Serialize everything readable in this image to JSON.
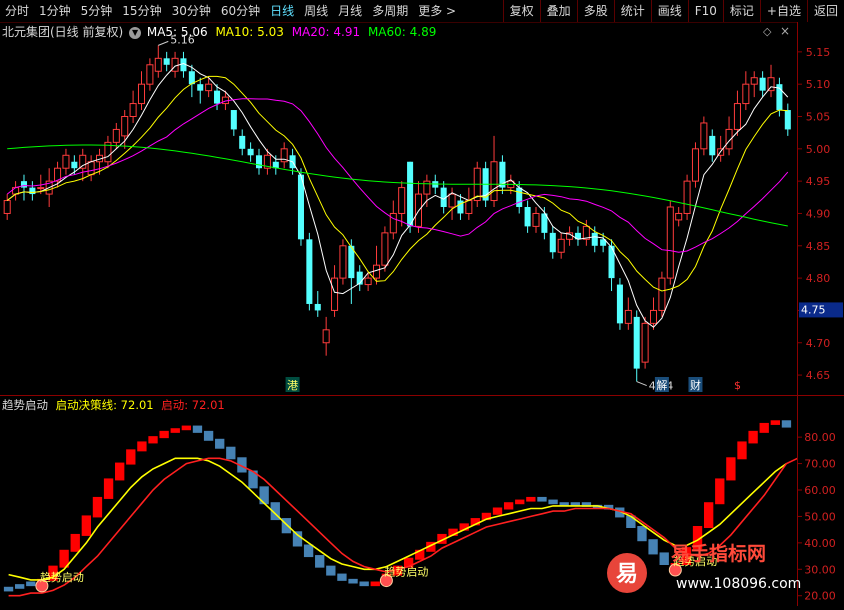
{
  "toolbar": {
    "left_items": [
      "分时",
      "1分钟",
      "5分钟",
      "15分钟",
      "30分钟",
      "60分钟",
      "日线",
      "周线",
      "月线",
      "多周期",
      "更多 >"
    ],
    "active_index": 6,
    "right_items": [
      "复权",
      "叠加",
      "多股",
      "统计",
      "画线",
      "F10",
      "标记",
      "+自选",
      "返回"
    ]
  },
  "main_title": {
    "stock": "北元集团(日线 前复权)",
    "ma5": "MA5: 5.06",
    "ma10": "MA10: 5.03",
    "ma20": "MA20: 4.91",
    "ma60": "MA60: 4.89"
  },
  "sub_title": {
    "name": "趋势启动",
    "line1": "启动决策线: 72.01",
    "line2": "启动: 72.01"
  },
  "price_axis": {
    "ticks": [
      "5.15",
      "5.10",
      "5.05",
      "5.00",
      "4.95",
      "4.90",
      "4.85",
      "4.80",
      "4.75",
      "4.70",
      "4.65"
    ],
    "current": "4.75"
  },
  "indicator_axis": {
    "ticks": [
      "80.00",
      "70.00",
      "60.00",
      "50.00",
      "40.00",
      "30.00",
      "20.00"
    ]
  },
  "annotations": {
    "high_label": "5.16",
    "low_label": "4.64",
    "event_labels": [
      "港",
      "解",
      "财",
      "$"
    ]
  },
  "signals": [
    "趋势启动",
    "趋势启动",
    "趋势启动"
  ],
  "watermark": {
    "site": "易手指标网",
    "url": "www.108096.com",
    "logo_char": "易"
  },
  "colors": {
    "up": "#ff3c3c",
    "down": "#54ffff",
    "ma5": "#ffffff",
    "ma10": "#ffff00",
    "ma20": "#ff00ff",
    "ma60": "#00ff00",
    "bar_up": "#ff0000",
    "bar_down": "#4682b4",
    "decision_line": "#ffff00",
    "start_line": "#ff2020"
  },
  "chart_data": {
    "type": "candlestick",
    "y_range": [
      4.63,
      5.19
    ],
    "candles": [
      {
        "o": 4.9,
        "c": 4.92,
        "h": 4.93,
        "l": 4.89
      },
      {
        "o": 4.93,
        "c": 4.94,
        "h": 4.95,
        "l": 4.92
      },
      {
        "o": 4.95,
        "c": 4.94,
        "h": 4.96,
        "l": 4.92
      },
      {
        "o": 4.94,
        "c": 4.93,
        "h": 4.95,
        "l": 4.92
      },
      {
        "o": 4.94,
        "c": 4.94,
        "h": 4.96,
        "l": 4.93
      },
      {
        "o": 4.93,
        "c": 4.95,
        "h": 4.97,
        "l": 4.91
      },
      {
        "o": 4.95,
        "c": 4.97,
        "h": 4.98,
        "l": 4.94
      },
      {
        "o": 4.97,
        "c": 4.99,
        "h": 5.0,
        "l": 4.96
      },
      {
        "o": 4.98,
        "c": 4.97,
        "h": 4.99,
        "l": 4.96
      },
      {
        "o": 4.97,
        "c": 4.99,
        "h": 5.0,
        "l": 4.95
      },
      {
        "o": 4.96,
        "c": 4.98,
        "h": 4.99,
        "l": 4.95
      },
      {
        "o": 4.98,
        "c": 4.99,
        "h": 5.0,
        "l": 4.96
      },
      {
        "o": 4.98,
        "c": 5.01,
        "h": 5.02,
        "l": 4.97
      },
      {
        "o": 5.01,
        "c": 5.03,
        "h": 5.04,
        "l": 5.0
      },
      {
        "o": 5.02,
        "c": 5.05,
        "h": 5.06,
        "l": 5.0
      },
      {
        "o": 5.05,
        "c": 5.07,
        "h": 5.09,
        "l": 5.04
      },
      {
        "o": 5.07,
        "c": 5.1,
        "h": 5.12,
        "l": 5.06
      },
      {
        "o": 5.1,
        "c": 5.13,
        "h": 5.14,
        "l": 5.09
      },
      {
        "o": 5.12,
        "c": 5.14,
        "h": 5.16,
        "l": 5.11
      },
      {
        "o": 5.14,
        "c": 5.13,
        "h": 5.15,
        "l": 5.12
      },
      {
        "o": 5.12,
        "c": 5.14,
        "h": 5.15,
        "l": 5.11
      },
      {
        "o": 5.14,
        "c": 5.12,
        "h": 5.15,
        "l": 5.11
      },
      {
        "o": 5.12,
        "c": 5.1,
        "h": 5.13,
        "l": 5.08
      },
      {
        "o": 5.1,
        "c": 5.09,
        "h": 5.11,
        "l": 5.07
      },
      {
        "o": 5.09,
        "c": 5.1,
        "h": 5.11,
        "l": 5.08
      },
      {
        "o": 5.09,
        "c": 5.07,
        "h": 5.1,
        "l": 5.06
      },
      {
        "o": 5.07,
        "c": 5.08,
        "h": 5.09,
        "l": 5.06
      },
      {
        "o": 5.06,
        "c": 5.03,
        "h": 5.06,
        "l": 5.02
      },
      {
        "o": 5.02,
        "c": 5.0,
        "h": 5.03,
        "l": 4.99
      },
      {
        "o": 5.0,
        "c": 4.99,
        "h": 5.01,
        "l": 4.98
      },
      {
        "o": 4.99,
        "c": 4.97,
        "h": 5.0,
        "l": 4.96
      },
      {
        "o": 4.97,
        "c": 4.99,
        "h": 5.0,
        "l": 4.96
      },
      {
        "o": 4.98,
        "c": 4.97,
        "h": 4.99,
        "l": 4.96
      },
      {
        "o": 4.98,
        "c": 5.0,
        "h": 5.01,
        "l": 4.97
      },
      {
        "o": 4.99,
        "c": 4.97,
        "h": 5.0,
        "l": 4.96
      },
      {
        "o": 4.96,
        "c": 4.86,
        "h": 4.97,
        "l": 4.85
      },
      {
        "o": 4.86,
        "c": 4.76,
        "h": 4.87,
        "l": 4.75
      },
      {
        "o": 4.76,
        "c": 4.75,
        "h": 4.78,
        "l": 4.74
      },
      {
        "o": 4.7,
        "c": 4.72,
        "h": 4.74,
        "l": 4.68
      },
      {
        "o": 4.75,
        "c": 4.8,
        "h": 4.82,
        "l": 4.74
      },
      {
        "o": 4.8,
        "c": 4.85,
        "h": 4.86,
        "l": 4.79
      },
      {
        "o": 4.85,
        "c": 4.8,
        "h": 4.86,
        "l": 4.76
      },
      {
        "o": 4.81,
        "c": 4.79,
        "h": 4.82,
        "l": 4.78
      },
      {
        "o": 4.79,
        "c": 4.8,
        "h": 4.81,
        "l": 4.78
      },
      {
        "o": 4.8,
        "c": 4.82,
        "h": 4.85,
        "l": 4.79
      },
      {
        "o": 4.82,
        "c": 4.87,
        "h": 4.88,
        "l": 4.81
      },
      {
        "o": 4.87,
        "c": 4.9,
        "h": 4.92,
        "l": 4.86
      },
      {
        "o": 4.9,
        "c": 4.94,
        "h": 4.95,
        "l": 4.88
      },
      {
        "o": 4.98,
        "c": 4.88,
        "h": 4.98,
        "l": 4.87
      },
      {
        "o": 4.88,
        "c": 4.93,
        "h": 4.95,
        "l": 4.87
      },
      {
        "o": 4.93,
        "c": 4.95,
        "h": 4.96,
        "l": 4.91
      },
      {
        "o": 4.95,
        "c": 4.94,
        "h": 4.96,
        "l": 4.93
      },
      {
        "o": 4.94,
        "c": 4.91,
        "h": 4.95,
        "l": 4.9
      },
      {
        "o": 4.91,
        "c": 4.93,
        "h": 4.94,
        "l": 4.89
      },
      {
        "o": 4.92,
        "c": 4.9,
        "h": 4.93,
        "l": 4.89
      },
      {
        "o": 4.9,
        "c": 4.92,
        "h": 4.94,
        "l": 4.89
      },
      {
        "o": 4.92,
        "c": 4.97,
        "h": 4.98,
        "l": 4.91
      },
      {
        "o": 4.97,
        "c": 4.92,
        "h": 4.98,
        "l": 4.91
      },
      {
        "o": 4.92,
        "c": 4.98,
        "h": 5.02,
        "l": 4.91
      },
      {
        "o": 4.98,
        "c": 4.94,
        "h": 4.99,
        "l": 4.93
      },
      {
        "o": 4.94,
        "c": 4.95,
        "h": 4.96,
        "l": 4.93
      },
      {
        "o": 4.94,
        "c": 4.91,
        "h": 4.95,
        "l": 4.9
      },
      {
        "o": 4.91,
        "c": 4.88,
        "h": 4.92,
        "l": 4.87
      },
      {
        "o": 4.88,
        "c": 4.9,
        "h": 4.91,
        "l": 4.87
      },
      {
        "o": 4.9,
        "c": 4.87,
        "h": 4.91,
        "l": 4.86
      },
      {
        "o": 4.87,
        "c": 4.84,
        "h": 4.88,
        "l": 4.83
      },
      {
        "o": 4.84,
        "c": 4.86,
        "h": 4.87,
        "l": 4.83
      },
      {
        "o": 4.86,
        "c": 4.87,
        "h": 4.88,
        "l": 4.85
      },
      {
        "o": 4.87,
        "c": 4.86,
        "h": 4.88,
        "l": 4.85
      },
      {
        "o": 4.86,
        "c": 4.88,
        "h": 4.89,
        "l": 4.85
      },
      {
        "o": 4.87,
        "c": 4.85,
        "h": 4.88,
        "l": 4.84
      },
      {
        "o": 4.86,
        "c": 4.85,
        "h": 4.87,
        "l": 4.84
      },
      {
        "o": 4.85,
        "c": 4.8,
        "h": 4.86,
        "l": 4.78
      },
      {
        "o": 4.79,
        "c": 4.73,
        "h": 4.8,
        "l": 4.72
      },
      {
        "o": 4.73,
        "c": 4.75,
        "h": 4.77,
        "l": 4.72
      },
      {
        "o": 4.74,
        "c": 4.66,
        "h": 4.75,
        "l": 4.64
      },
      {
        "o": 4.67,
        "c": 4.73,
        "h": 4.74,
        "l": 4.66
      },
      {
        "o": 4.73,
        "c": 4.75,
        "h": 4.77,
        "l": 4.72
      },
      {
        "o": 4.75,
        "c": 4.8,
        "h": 4.81,
        "l": 4.74
      },
      {
        "o": 4.8,
        "c": 4.91,
        "h": 4.92,
        "l": 4.79
      },
      {
        "o": 4.89,
        "c": 4.9,
        "h": 4.91,
        "l": 4.88
      },
      {
        "o": 4.9,
        "c": 4.95,
        "h": 4.96,
        "l": 4.89
      },
      {
        "o": 4.95,
        "c": 5.0,
        "h": 5.01,
        "l": 4.94
      },
      {
        "o": 5.0,
        "c": 5.04,
        "h": 5.05,
        "l": 4.99
      },
      {
        "o": 5.02,
        "c": 4.99,
        "h": 5.03,
        "l": 4.98
      },
      {
        "o": 4.99,
        "c": 5.0,
        "h": 5.02,
        "l": 4.98
      },
      {
        "o": 5.0,
        "c": 5.03,
        "h": 5.05,
        "l": 4.99
      },
      {
        "o": 5.03,
        "c": 5.07,
        "h": 5.09,
        "l": 5.02
      },
      {
        "o": 5.07,
        "c": 5.1,
        "h": 5.12,
        "l": 5.06
      },
      {
        "o": 5.1,
        "c": 5.11,
        "h": 5.12,
        "l": 5.08
      },
      {
        "o": 5.11,
        "c": 5.09,
        "h": 5.12,
        "l": 5.08
      },
      {
        "o": 5.09,
        "c": 5.11,
        "h": 5.13,
        "l": 5.08
      },
      {
        "o": 5.1,
        "c": 5.06,
        "h": 5.11,
        "l": 5.05
      },
      {
        "o": 5.06,
        "c": 5.03,
        "h": 5.07,
        "l": 5.02
      }
    ],
    "indicator_y_range": [
      18,
      88
    ],
    "histogram": [
      {
        "v": 23,
        "up": false
      },
      {
        "v": 24,
        "up": false
      },
      {
        "v": 25,
        "up": false
      },
      {
        "v": 26,
        "up": true
      },
      {
        "v": 31,
        "up": true
      },
      {
        "v": 37,
        "up": true
      },
      {
        "v": 43,
        "up": true
      },
      {
        "v": 50,
        "up": true
      },
      {
        "v": 57,
        "up": true
      },
      {
        "v": 64,
        "up": true
      },
      {
        "v": 70,
        "up": true
      },
      {
        "v": 75,
        "up": true
      },
      {
        "v": 78,
        "up": true
      },
      {
        "v": 80,
        "up": true
      },
      {
        "v": 82,
        "up": true
      },
      {
        "v": 83,
        "up": true
      },
      {
        "v": 84,
        "up": true
      },
      {
        "v": 82,
        "up": false
      },
      {
        "v": 79,
        "up": false
      },
      {
        "v": 76,
        "up": false
      },
      {
        "v": 72,
        "up": false
      },
      {
        "v": 67,
        "up": false
      },
      {
        "v": 61,
        "up": false
      },
      {
        "v": 55,
        "up": false
      },
      {
        "v": 49,
        "up": false
      },
      {
        "v": 44,
        "up": false
      },
      {
        "v": 39,
        "up": false
      },
      {
        "v": 35,
        "up": false
      },
      {
        "v": 31,
        "up": false
      },
      {
        "v": 28,
        "up": false
      },
      {
        "v": 26,
        "up": false
      },
      {
        "v": 25,
        "up": false
      },
      {
        "v": 24,
        "up": false
      },
      {
        "v": 25,
        "up": true
      },
      {
        "v": 28,
        "up": true
      },
      {
        "v": 31,
        "up": true
      },
      {
        "v": 34,
        "up": true
      },
      {
        "v": 37,
        "up": true
      },
      {
        "v": 40,
        "up": true
      },
      {
        "v": 43,
        "up": true
      },
      {
        "v": 45,
        "up": true
      },
      {
        "v": 47,
        "up": true
      },
      {
        "v": 49,
        "up": true
      },
      {
        "v": 51,
        "up": true
      },
      {
        "v": 53,
        "up": true
      },
      {
        "v": 55,
        "up": true
      },
      {
        "v": 56,
        "up": true
      },
      {
        "v": 57,
        "up": true
      },
      {
        "v": 56,
        "up": false
      },
      {
        "v": 55,
        "up": false
      },
      {
        "v": 55,
        "up": false
      },
      {
        "v": 55,
        "up": false
      },
      {
        "v": 54,
        "up": false
      },
      {
        "v": 54,
        "up": false
      },
      {
        "v": 53,
        "up": false
      },
      {
        "v": 50,
        "up": false
      },
      {
        "v": 46,
        "up": false
      },
      {
        "v": 41,
        "up": false
      },
      {
        "v": 36,
        "up": false
      },
      {
        "v": 32,
        "up": false
      },
      {
        "v": 32,
        "up": true
      },
      {
        "v": 38,
        "up": true
      },
      {
        "v": 46,
        "up": true
      },
      {
        "v": 55,
        "up": true
      },
      {
        "v": 64,
        "up": true
      },
      {
        "v": 72,
        "up": true
      },
      {
        "v": 78,
        "up": true
      },
      {
        "v": 82,
        "up": true
      },
      {
        "v": 85,
        "up": true
      },
      {
        "v": 86,
        "up": true
      },
      {
        "v": 84,
        "up": false
      }
    ],
    "decision_line": [
      28,
      27,
      26,
      26,
      27,
      30,
      35,
      40,
      46,
      51,
      56,
      61,
      65,
      68,
      70,
      72,
      72,
      72,
      71,
      69,
      66,
      63,
      59,
      55,
      51,
      47,
      43,
      40,
      37,
      34,
      32,
      31,
      30,
      30,
      31,
      33,
      35,
      37,
      39,
      41,
      43,
      45,
      47,
      49,
      50,
      51,
      52,
      53,
      53,
      54,
      54,
      54,
      54,
      54,
      53,
      52,
      50,
      47,
      44,
      41,
      39,
      39,
      41,
      44,
      47,
      51,
      55,
      59,
      63,
      67,
      70
    ],
    "start_line": [
      20,
      20,
      21,
      21,
      22,
      24,
      27,
      31,
      35,
      40,
      45,
      50,
      55,
      60,
      64,
      67,
      70,
      71,
      72,
      72,
      71,
      69,
      67,
      64,
      60,
      56,
      52,
      48,
      44,
      40,
      36,
      33,
      31,
      30,
      29,
      30,
      31,
      33,
      35,
      38,
      40,
      42,
      44,
      46,
      47,
      48,
      49,
      50,
      51,
      52,
      52,
      53,
      53,
      53,
      53,
      52,
      51,
      48,
      45,
      42,
      38,
      36,
      35,
      36,
      39,
      43,
      48,
      53,
      58,
      64,
      70,
      72
    ]
  }
}
